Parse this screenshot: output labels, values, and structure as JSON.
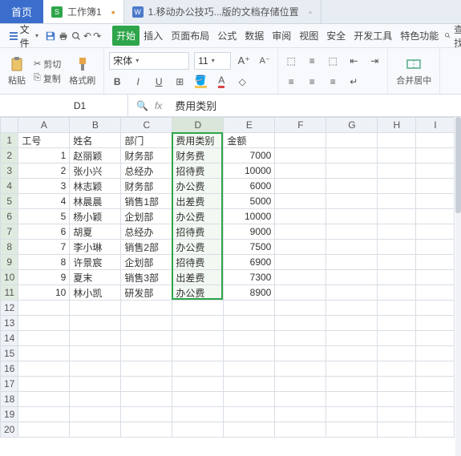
{
  "tabs": {
    "home": "首页",
    "doc1": "工作簿1",
    "doc2": "1.移动办公技巧...版的文档存储位置"
  },
  "menu": {
    "file": "文件",
    "search": "查找"
  },
  "ribbon": {
    "tabs": [
      "开始",
      "插入",
      "页面布局",
      "公式",
      "数据",
      "审阅",
      "视图",
      "安全",
      "开发工具",
      "特色功能"
    ]
  },
  "toolbar": {
    "paste": "粘贴",
    "cut": "剪切",
    "copy": "复制",
    "format_painter": "格式刷",
    "font_name": "宋体",
    "font_size": "11",
    "merge_center": "合并居中"
  },
  "formula_bar": {
    "cell_ref": "D1",
    "value": "费用类别"
  },
  "sheet": {
    "columns": [
      "A",
      "B",
      "C",
      "D",
      "E",
      "F",
      "G",
      "H",
      "I"
    ],
    "headers": {
      "A": "工号",
      "B": "姓名",
      "C": "部门",
      "D": "费用类别",
      "E": "金额"
    },
    "rows": [
      {
        "n": 1,
        "A": "1",
        "B": "赵丽颖",
        "C": "财务部",
        "D": "财务费",
        "E": "7000"
      },
      {
        "n": 2,
        "A": "2",
        "B": "张小兴",
        "C": "总经办",
        "D": "招待费",
        "E": "10000"
      },
      {
        "n": 3,
        "A": "3",
        "B": "林志颖",
        "C": "财务部",
        "D": "办公费",
        "E": "6000"
      },
      {
        "n": 4,
        "A": "4",
        "B": "林晨晨",
        "C": "销售1部",
        "D": "出差费",
        "E": "5000"
      },
      {
        "n": 5,
        "A": "5",
        "B": "杨小颖",
        "C": "企划部",
        "D": "办公费",
        "E": "10000"
      },
      {
        "n": 6,
        "A": "6",
        "B": "胡夏",
        "C": "总经办",
        "D": "招待费",
        "E": "9000"
      },
      {
        "n": 7,
        "A": "7",
        "B": "李小琳",
        "C": "销售2部",
        "D": "办公费",
        "E": "7500"
      },
      {
        "n": 8,
        "A": "8",
        "B": "许景宸",
        "C": "企划部",
        "D": "招待费",
        "E": "6900"
      },
      {
        "n": 9,
        "A": "9",
        "B": "夏末",
        "C": "销售3部",
        "D": "出差费",
        "E": "7300"
      },
      {
        "n": 10,
        "A": "10",
        "B": "林小凯",
        "C": "研发部",
        "D": "办公费",
        "E": "8900"
      }
    ],
    "empty_rows": 9,
    "selected_col_index": 3,
    "active_cell": "D1"
  },
  "colors": {
    "accent": "#2ea54a",
    "primary": "#3b6ecc"
  }
}
